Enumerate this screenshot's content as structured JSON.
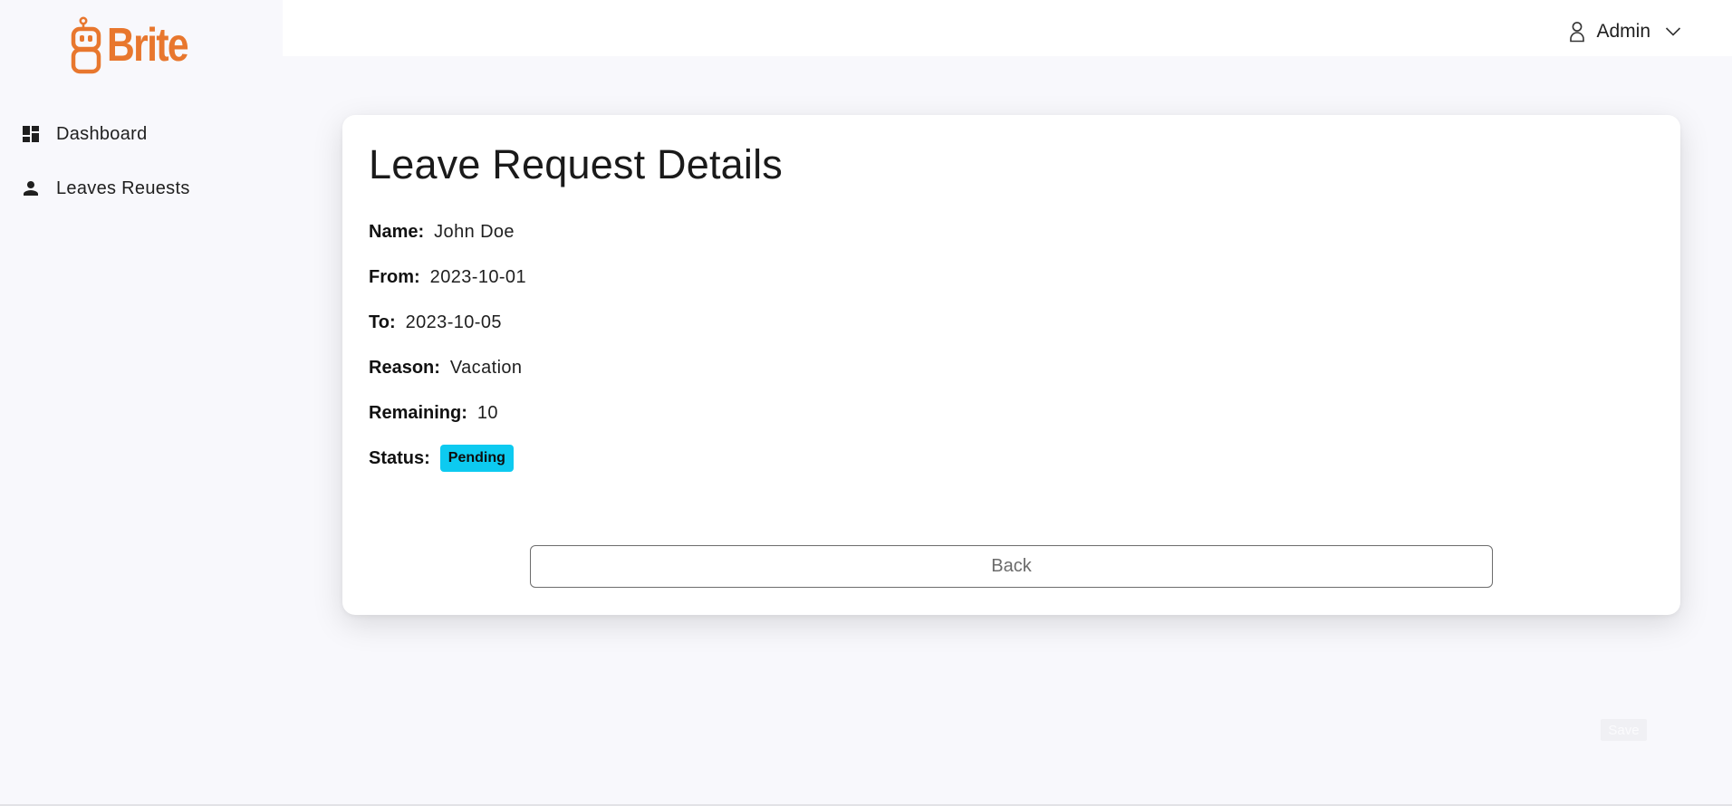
{
  "brand": {
    "name": "Brite",
    "accent": "#e8772e"
  },
  "sidebar": {
    "items": [
      {
        "label": "Dashboard",
        "icon": "dashboard-icon"
      },
      {
        "label": "Leaves Reuests",
        "icon": "person-icon"
      }
    ]
  },
  "header": {
    "user_label": "Admin",
    "user_icon": "user-icon",
    "menu_icon": "chevron-down-icon"
  },
  "details": {
    "title": "Leave Request Details",
    "name_label": "Name:",
    "name_value": "John Doe",
    "from_label": "From:",
    "from_value": "2023-10-01",
    "to_label": "To:",
    "to_value": "2023-10-05",
    "reason_label": "Reason:",
    "reason_value": "Vacation",
    "remaining_label": "Remaining:",
    "remaining_value": "10",
    "status_label": "Status:",
    "status_value": "Pending",
    "status_color": "#0dcaf0",
    "back_label": "Back"
  },
  "footer": {
    "save_label": "Save"
  }
}
